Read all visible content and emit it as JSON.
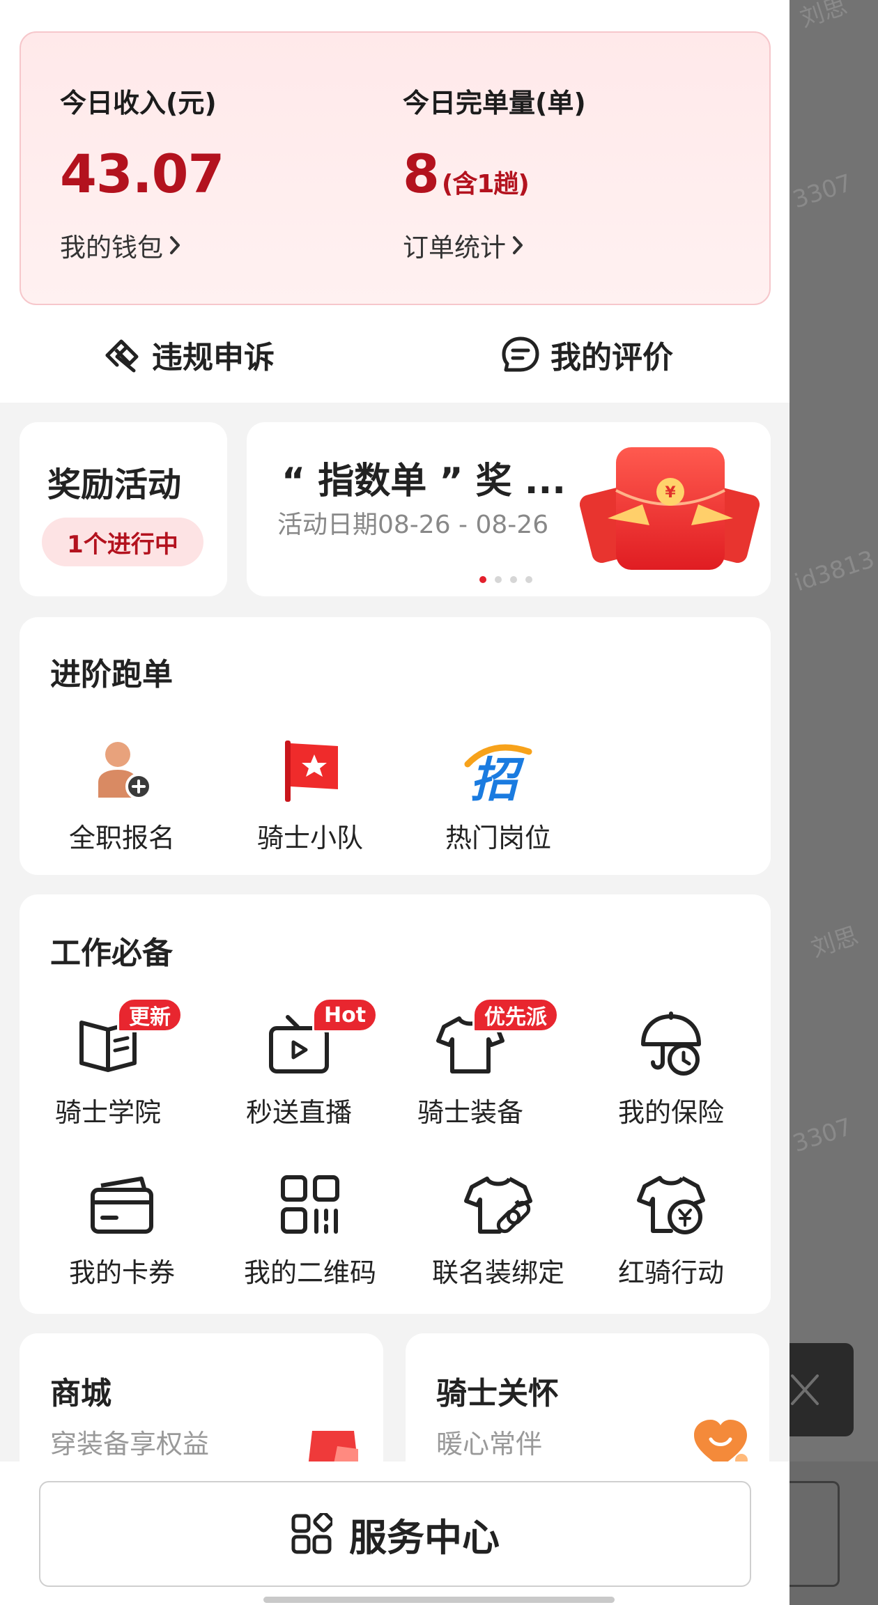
{
  "income": {
    "today_income_label": "今日收入(元)",
    "today_income_value": "43.07",
    "wallet_link": "我的钱包",
    "today_orders_label": "今日完单量(单)",
    "today_orders_value": "8",
    "today_orders_sub": "(含1趟)",
    "order_stats_link": "订单统计"
  },
  "quick_actions": {
    "appeal": "违规申诉",
    "my_reviews": "我的评价"
  },
  "reward": {
    "title": "奖励活动",
    "status": "1个进行中"
  },
  "banner": {
    "title": "“ 指数单 ” 奖 ...",
    "date": "活动日期08-26 - 08-26",
    "dots_total": 4,
    "active_dot": 1
  },
  "advanced": {
    "title": "进阶跑单",
    "items": [
      {
        "label": "全职报名",
        "icon": "fulltime-signup-icon"
      },
      {
        "label": "骑士小队",
        "icon": "team-flag-icon"
      },
      {
        "label": "热门岗位",
        "icon": "hot-job-icon"
      }
    ]
  },
  "essentials": {
    "title": "工作必备",
    "items": [
      {
        "label": "骑士学院",
        "icon": "book-icon",
        "badge": "更新"
      },
      {
        "label": "秒送直播",
        "icon": "tv-play-icon",
        "badge": "Hot"
      },
      {
        "label": "骑士装备",
        "icon": "tshirt-icon",
        "badge": "优先派"
      },
      {
        "label": "我的保险",
        "icon": "umbrella-clock-icon",
        "badge": ""
      },
      {
        "label": "我的卡券",
        "icon": "card-icon",
        "badge": ""
      },
      {
        "label": "我的二维码",
        "icon": "qr-code-icon",
        "badge": ""
      },
      {
        "label": "联名装绑定",
        "icon": "shirt-link-icon",
        "badge": ""
      },
      {
        "label": "红骑行动",
        "icon": "shirt-yen-icon",
        "badge": ""
      }
    ]
  },
  "mall": {
    "title": "商城",
    "subtitle": "穿装备享权益"
  },
  "care": {
    "title": "骑士关怀",
    "subtitle": "暖心常伴"
  },
  "service_center": {
    "label": "服务中心"
  },
  "watermark": {
    "text1": "刘思",
    "text2": "3307",
    "text3": "id3813",
    "text4": "刘思",
    "text5": "3307"
  },
  "colors": {
    "accent_red": "#b3121e",
    "badge_red": "#e8262f",
    "card_pink": "#ffe9ea"
  }
}
